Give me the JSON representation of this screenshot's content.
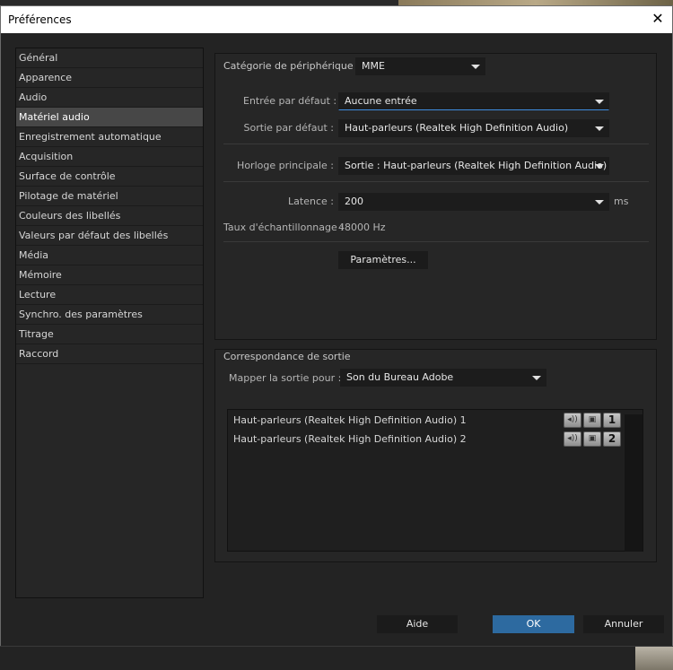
{
  "window": {
    "title": "Préférences",
    "close_glyph": "✕"
  },
  "sidebar": {
    "items": [
      {
        "label": "Général"
      },
      {
        "label": "Apparence"
      },
      {
        "label": "Audio"
      },
      {
        "label": "Matériel audio",
        "active": true
      },
      {
        "label": "Enregistrement automatique"
      },
      {
        "label": "Acquisition"
      },
      {
        "label": "Surface de contrôle"
      },
      {
        "label": "Pilotage de matériel"
      },
      {
        "label": "Couleurs des libellés"
      },
      {
        "label": "Valeurs par défaut des libellés"
      },
      {
        "label": "Média"
      },
      {
        "label": "Mémoire"
      },
      {
        "label": "Lecture"
      },
      {
        "label": "Synchro. des paramètres"
      },
      {
        "label": "Titrage"
      },
      {
        "label": "Raccord"
      }
    ]
  },
  "device": {
    "category_label": "Catégorie de périphérique :",
    "category_value": "MME",
    "input_label": "Entrée par défaut :",
    "input_value": "Aucune entrée",
    "output_label": "Sortie par défaut :",
    "output_value": "Haut-parleurs (Realtek High Definition Audio)",
    "clock_label": "Horloge principale :",
    "clock_value": "Sortie : Haut-parleurs (Realtek High Definition Audio)",
    "latency_label": "Latence :",
    "latency_value": "200",
    "latency_unit": "ms",
    "sample_rate_label": "Taux d'échantillonnage :",
    "sample_rate_value": "48000 Hz",
    "settings_button": "Paramètres..."
  },
  "output_mapping": {
    "section_label": "Correspondance de sortie",
    "map_label": "Mapper la sortie pour :",
    "map_value": "Son du Bureau Adobe",
    "rows": [
      {
        "name": "Haut-parleurs (Realtek High Definition Audio) 1",
        "channel": "1"
      },
      {
        "name": "Haut-parleurs (Realtek High Definition Audio) 2",
        "channel": "2"
      }
    ]
  },
  "footer": {
    "help_button": "Aide",
    "ok_button": "OK",
    "cancel_button": "Annuler"
  },
  "colors": {
    "accent": "#2d6aa0",
    "active_item": "#474747",
    "panel": "#262626"
  }
}
